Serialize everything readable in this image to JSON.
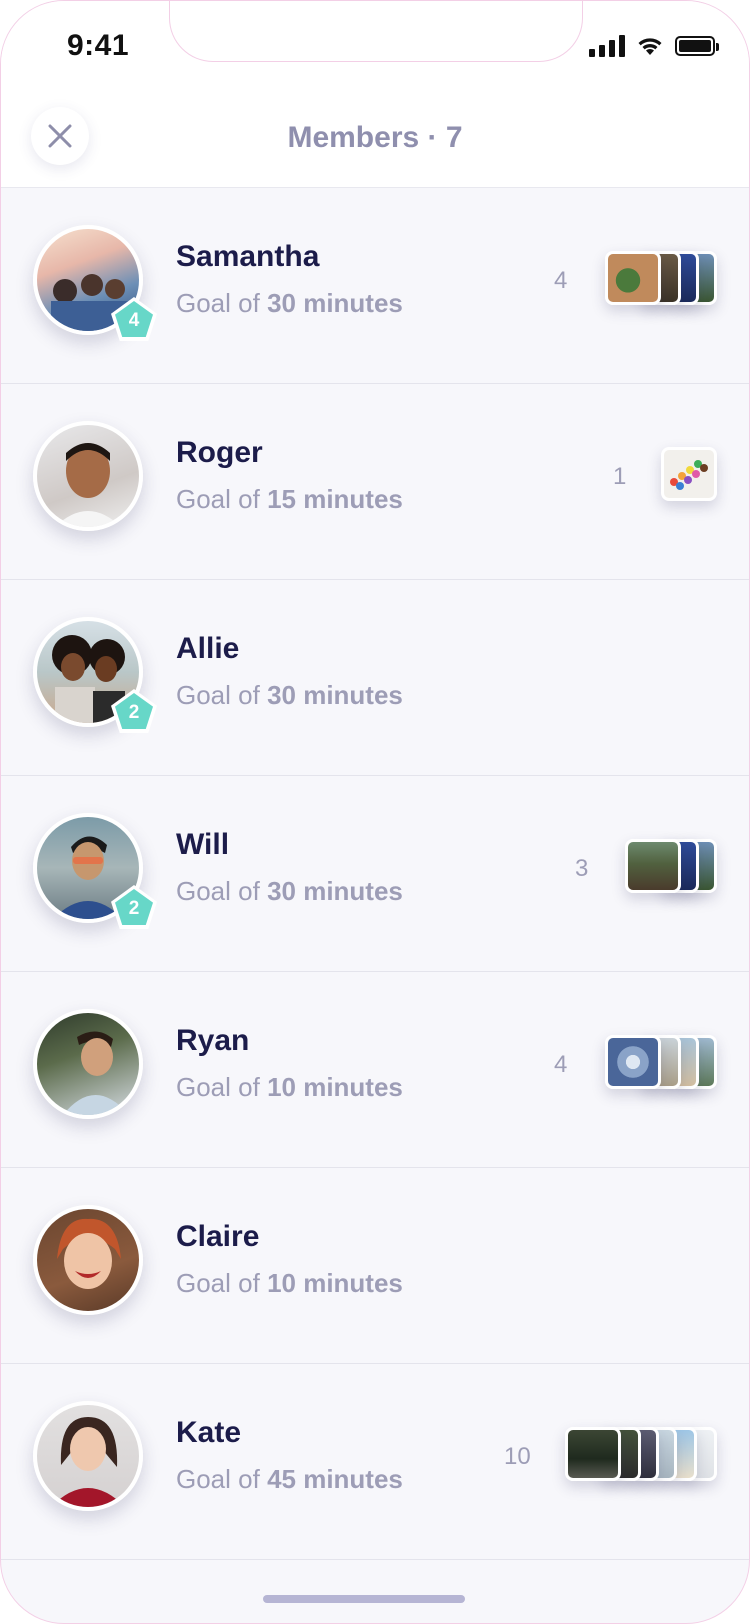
{
  "status_bar": {
    "time": "9:41"
  },
  "header": {
    "title": "Members · 7"
  },
  "members": [
    {
      "name": "Samantha",
      "goal_prefix": "Goal of ",
      "goal_value": "30 minutes",
      "badge": "4",
      "count": "4"
    },
    {
      "name": "Roger",
      "goal_prefix": "Goal of ",
      "goal_value": "15 minutes",
      "badge": "",
      "count": "1"
    },
    {
      "name": "Allie",
      "goal_prefix": "Goal of ",
      "goal_value": "30 minutes",
      "badge": "2",
      "count": ""
    },
    {
      "name": "Will",
      "goal_prefix": "Goal of ",
      "goal_value": "30 minutes",
      "badge": "2",
      "count": "3"
    },
    {
      "name": "Ryan",
      "goal_prefix": "Goal of ",
      "goal_value": "10 minutes",
      "badge": "",
      "count": "4"
    },
    {
      "name": "Claire",
      "goal_prefix": "Goal of ",
      "goal_value": "10 minutes",
      "badge": "",
      "count": ""
    },
    {
      "name": "Kate",
      "goal_prefix": "Goal of ",
      "goal_value": "45 minutes",
      "badge": "",
      "count": "10"
    }
  ],
  "colors": {
    "accent": "#67d7c8",
    "name": "#1c1c4a",
    "muted": "#9d9db6",
    "title": "#8f8fae"
  }
}
